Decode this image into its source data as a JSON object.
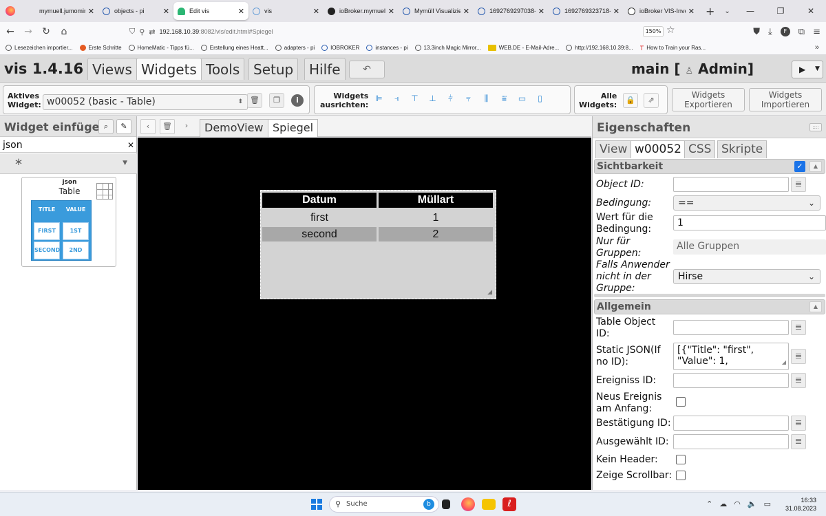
{
  "browser": {
    "tabs": [
      {
        "title": "mymuell.jumomind.co",
        "icon": "globe-icon"
      },
      {
        "title": "objects - pi",
        "icon": "iobroker-icon"
      },
      {
        "title": "Edit vis",
        "icon": "vis-icon"
      },
      {
        "title": "vis",
        "icon": "cloud-icon"
      },
      {
        "title": "ioBroker.mymuell/",
        "icon": "github-icon"
      },
      {
        "title": "Mymüll Visualizier",
        "icon": "iobroker-icon"
      },
      {
        "title": "1692769297038-s",
        "icon": "iobroker-icon"
      },
      {
        "title": "1692769323718-s",
        "icon": "iobroker-icon"
      },
      {
        "title": "ioBroker VIS-Inven",
        "icon": "wikipedia-icon"
      }
    ],
    "url_main": "192.168.10.39",
    "url_rest": ":8082/vis/edit.html#Spiegel",
    "zoom": "150%",
    "bookmarks": [
      "Lesezeichen importier...",
      "Erste Schritte",
      "HomeMatic - Tipps fü...",
      "Erstellung eines Heatt...",
      "adapters - pi",
      "IOBROKER",
      "instances - pi",
      "13.3inch Magic Mirror...",
      "WEB.DE - E-Mail-Adre...",
      "http://192.168.10.39:8...",
      "How to Train your Ras..."
    ]
  },
  "vis": {
    "logo": "vis 1.4.16",
    "menu": [
      "Views",
      "Widgets",
      "Tools",
      "Setup",
      "Hilfe"
    ],
    "project": "main [",
    "user": "Admin]",
    "toolbar": {
      "active_label_1": "Aktives",
      "active_label_2": "Widget:",
      "active_widget": "w00052 (basic - Table)",
      "align_label_1": "Widgets",
      "align_label_2": "ausrichten:",
      "all_label_1": "Alle",
      "all_label_2": "Widgets:",
      "export_1": "Widgets",
      "export_2": "Exportieren",
      "import_1": "Widgets",
      "import_2": "Importieren"
    },
    "left": {
      "title": "Widget einfügen",
      "filter": "json",
      "set": "*",
      "card_set": "json",
      "card_name": "Table",
      "preview": {
        "h1": "TITLE",
        "h2": "VALUE",
        "r1c1": "FIRST",
        "r1c2": "1ST",
        "r2c1": "SECOND",
        "r2c2": "2ND"
      }
    },
    "views": [
      "DemoView",
      "Spiegel"
    ],
    "table_widget": {
      "headers": [
        "Datum",
        "Müllart"
      ],
      "rows": [
        [
          "first",
          "1"
        ],
        [
          "second",
          "2"
        ]
      ]
    },
    "props": {
      "title": "Eigenschaften",
      "tabs": [
        "View",
        "w00052",
        "CSS",
        "Skripte"
      ],
      "sec_visibility": "Sichtbarkeit",
      "object_id": "Object ID:",
      "condition": "Bedingung:",
      "condition_value": "==",
      "cond_value_1": "Wert für die",
      "cond_value_2": "Bedingung:",
      "cond_value_input": "1",
      "groups_1": "Nur für",
      "groups_2": "Gruppen:",
      "groups_value": "Alle Gruppen",
      "notin_1": "Falls Anwender",
      "notin_2": "nicht in der",
      "notin_3": "Gruppe:",
      "notin_value": "Hirse",
      "sec_general": "Allgemein",
      "table_oid_1": "Table Object",
      "table_oid_2": "ID:",
      "static_json_1": "Static JSON(If",
      "static_json_2": "no ID):",
      "static_json_value": "[{\"Title\": \"first\",\n\"Value\": 1,",
      "event_id": "Ereigniss ID:",
      "new_event_1": "Neus Ereignis",
      "new_event_2": "am Anfang:",
      "confirm_id": "Bestätigung ID:",
      "selected_id": "Ausgewählt ID:",
      "no_header": "Kein Header:",
      "show_scroll": "Zeige Scrollbar:"
    }
  },
  "taskbar": {
    "search": "Suche",
    "time": "16:33",
    "date": "31.08.2023"
  }
}
